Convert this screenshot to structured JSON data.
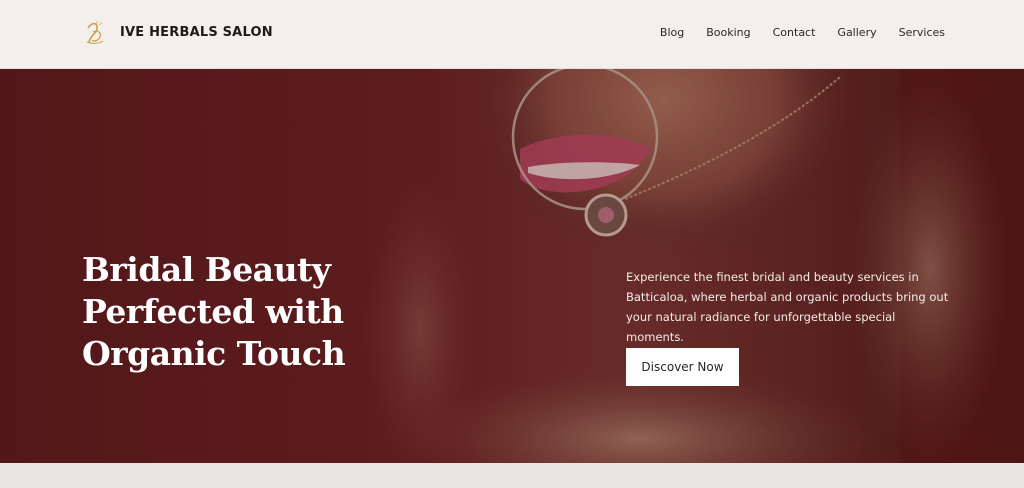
{
  "header": {
    "brand_name": "IVE HERBALS SALON",
    "logo_icon": "monogram-logo-icon",
    "nav": [
      {
        "label": "Blog"
      },
      {
        "label": "Booking"
      },
      {
        "label": "Contact"
      },
      {
        "label": "Gallery"
      },
      {
        "label": "Services"
      }
    ]
  },
  "hero": {
    "title": "Bridal Beauty Perfected with Organic Touch",
    "description": "Experience the finest bridal and beauty services in Batticaloa, where herbal and organic products bring out your natural radiance for unforgettable special moments.",
    "cta_label": "Discover Now",
    "background_image": "bridal-portrait-nose-ring-photo"
  },
  "colors": {
    "header_bg": "#f2efec",
    "hero_overlay": "#5e1c1e",
    "accent_gold": "#c9a24a",
    "text_light": "#ffffff",
    "text_dark": "#1f1a17"
  }
}
